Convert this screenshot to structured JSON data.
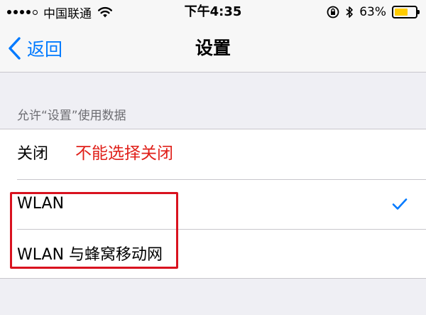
{
  "status_bar": {
    "carrier": "中国联通",
    "time": "下午4:35",
    "battery_percent_text": "63%",
    "battery_level": 0.63,
    "signal_bars_filled": 4,
    "signal_bars_total": 5,
    "battery_color": "#ffcc00"
  },
  "nav": {
    "back_label": "返回",
    "title": "设置",
    "accent_color": "#007aff"
  },
  "section": {
    "header": "允许“设置”使用数据",
    "options": [
      {
        "label": "关闭",
        "selected": false
      },
      {
        "label": "WLAN",
        "selected": true
      },
      {
        "label": "WLAN 与蜂窝移动网",
        "selected": false
      }
    ]
  },
  "annotation": {
    "text": "不能选择关闭",
    "color": "#e0201a",
    "box_color": "#d9121f"
  },
  "icons": {
    "back": "chevron-left-icon",
    "check": "checkmark-icon",
    "wifi": "wifi-icon",
    "lock": "rotation-lock-icon",
    "bluetooth": "bluetooth-icon",
    "battery": "battery-icon"
  }
}
